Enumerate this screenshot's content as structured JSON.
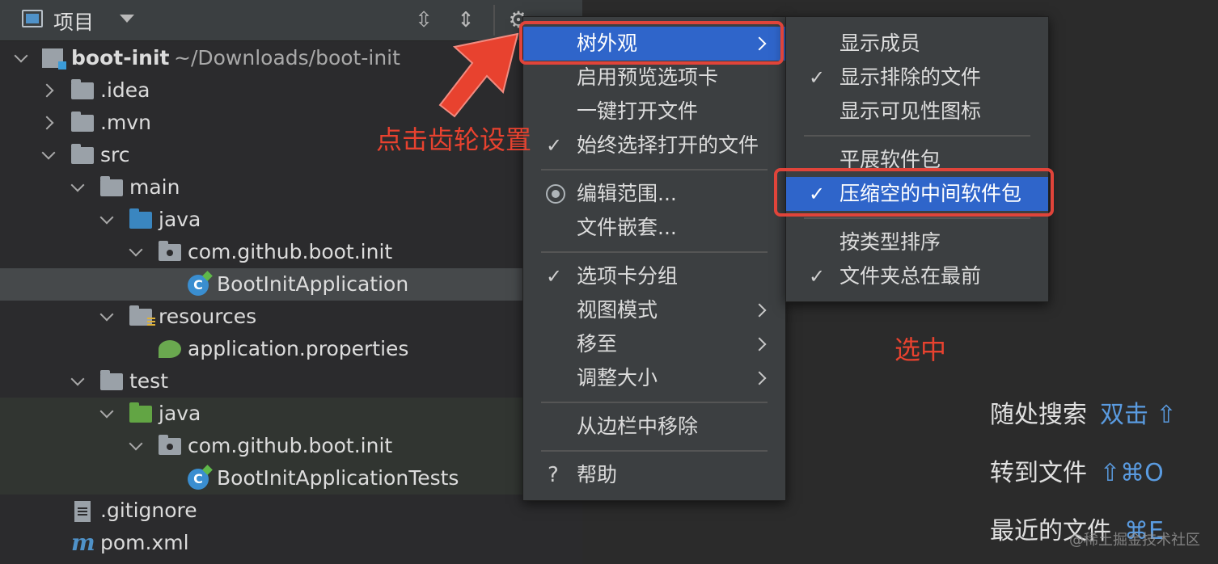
{
  "panel": {
    "title": "项目",
    "tree": [
      {
        "label": "boot-init",
        "path": "~/Downloads/boot-init"
      },
      {
        "label": ".idea"
      },
      {
        "label": ".mvn"
      },
      {
        "label": "src"
      },
      {
        "label": "main"
      },
      {
        "label": "java"
      },
      {
        "label": "com.github.boot.init"
      },
      {
        "label": "BootInitApplication"
      },
      {
        "label": "resources"
      },
      {
        "label": "application.properties"
      },
      {
        "label": "test"
      },
      {
        "label": "java"
      },
      {
        "label": "com.github.boot.init"
      },
      {
        "label": "BootInitApplicationTests"
      },
      {
        "label": ".gitignore"
      },
      {
        "label": "pom.xml"
      }
    ]
  },
  "menu": {
    "items": [
      {
        "label": "树外观"
      },
      {
        "label": "启用预览选项卡"
      },
      {
        "label": "一键打开文件"
      },
      {
        "label": "始终选择打开的文件"
      },
      {
        "label": "编辑范围..."
      },
      {
        "label": "文件嵌套..."
      },
      {
        "label": "选项卡分组"
      },
      {
        "label": "视图模式"
      },
      {
        "label": "移至"
      },
      {
        "label": "调整大小"
      },
      {
        "label": "从边栏中移除"
      },
      {
        "label": "帮助"
      }
    ]
  },
  "submenu": {
    "items": [
      {
        "label": "显示成员"
      },
      {
        "label": "显示排除的文件"
      },
      {
        "label": "显示可见性图标"
      },
      {
        "label": "平展软件包"
      },
      {
        "label": "压缩空的中间软件包"
      },
      {
        "label": "按类型排序"
      },
      {
        "label": "文件夹总在最前"
      }
    ]
  },
  "annotations": {
    "gear_note": "点击齿轮设置",
    "selected_note": "选中"
  },
  "hints": [
    {
      "label": "随处搜索",
      "key": "双击 ⇧"
    },
    {
      "label": "转到文件",
      "key": "⇧⌘O"
    },
    {
      "label": "最近的文件",
      "key": "⌘E"
    }
  ],
  "watermark": "@稀土掘金技术社区",
  "colors": {
    "highlight": "#2f65ca",
    "annotation": "#e8422f",
    "shortcut": "#5a9be0"
  },
  "icons": [
    "project-panel-icon",
    "expand-all-icon",
    "collapse-all-icon",
    "gear-icon",
    "check-icon",
    "radio-icon",
    "help-icon",
    "submenu-arrow-icon"
  ]
}
